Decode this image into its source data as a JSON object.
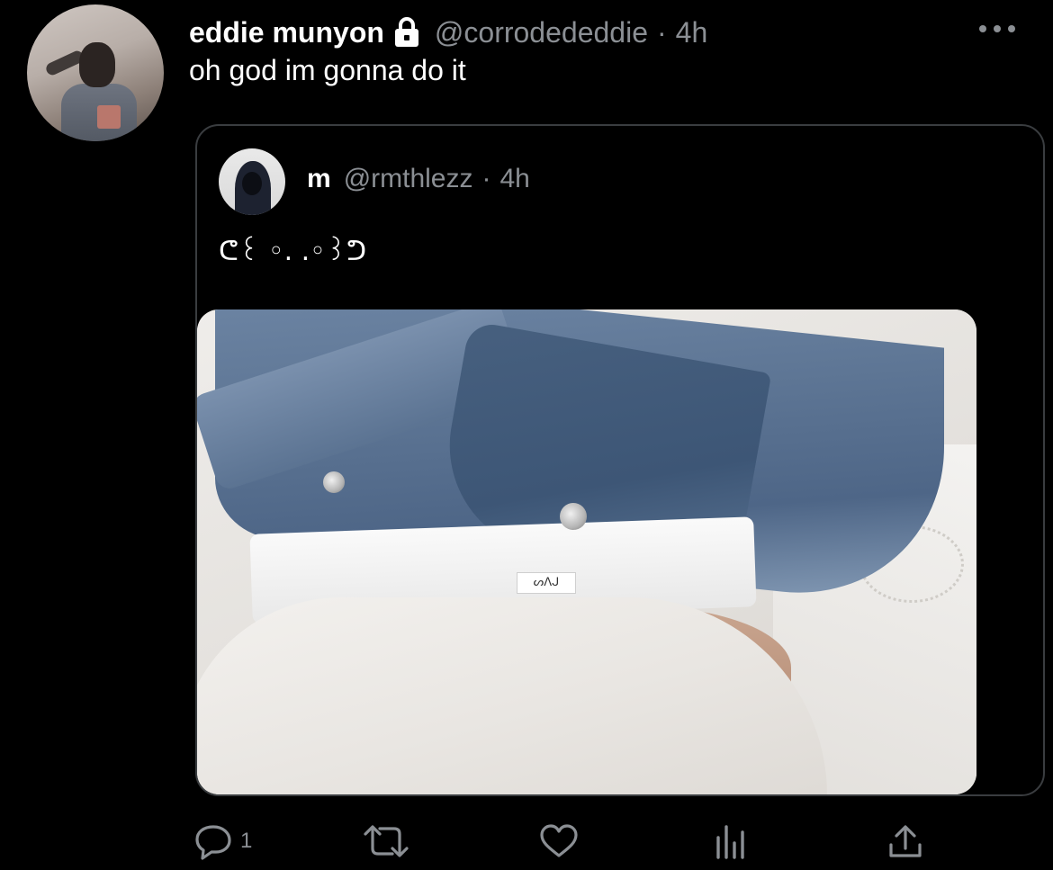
{
  "tweet": {
    "display_name": "eddie munyon",
    "handle": "@corrodededdie",
    "separator": "·",
    "time": "4h",
    "text": "oh god im gonna do it",
    "icons": {
      "lock": "lock-icon",
      "more": "more-icon"
    }
  },
  "quote": {
    "display_name": "m",
    "handle": "@rmthlezz",
    "separator": "·",
    "time": "4h",
    "text": "ᕦ꒰ ◦. .◦꒱ᕤ",
    "media": {
      "tag_text": "ᔕᐱᒍ"
    }
  },
  "actions": {
    "reply": {
      "icon": "reply-icon",
      "count": "1"
    },
    "retweet": {
      "icon": "retweet-icon"
    },
    "like": {
      "icon": "heart-icon"
    },
    "stats": {
      "icon": "analytics-icon"
    },
    "share": {
      "icon": "share-icon"
    }
  },
  "colors": {
    "background": "#000000",
    "primary_text": "#ffffff",
    "secondary_text": "#8b8f94",
    "border": "#3a3d40"
  }
}
